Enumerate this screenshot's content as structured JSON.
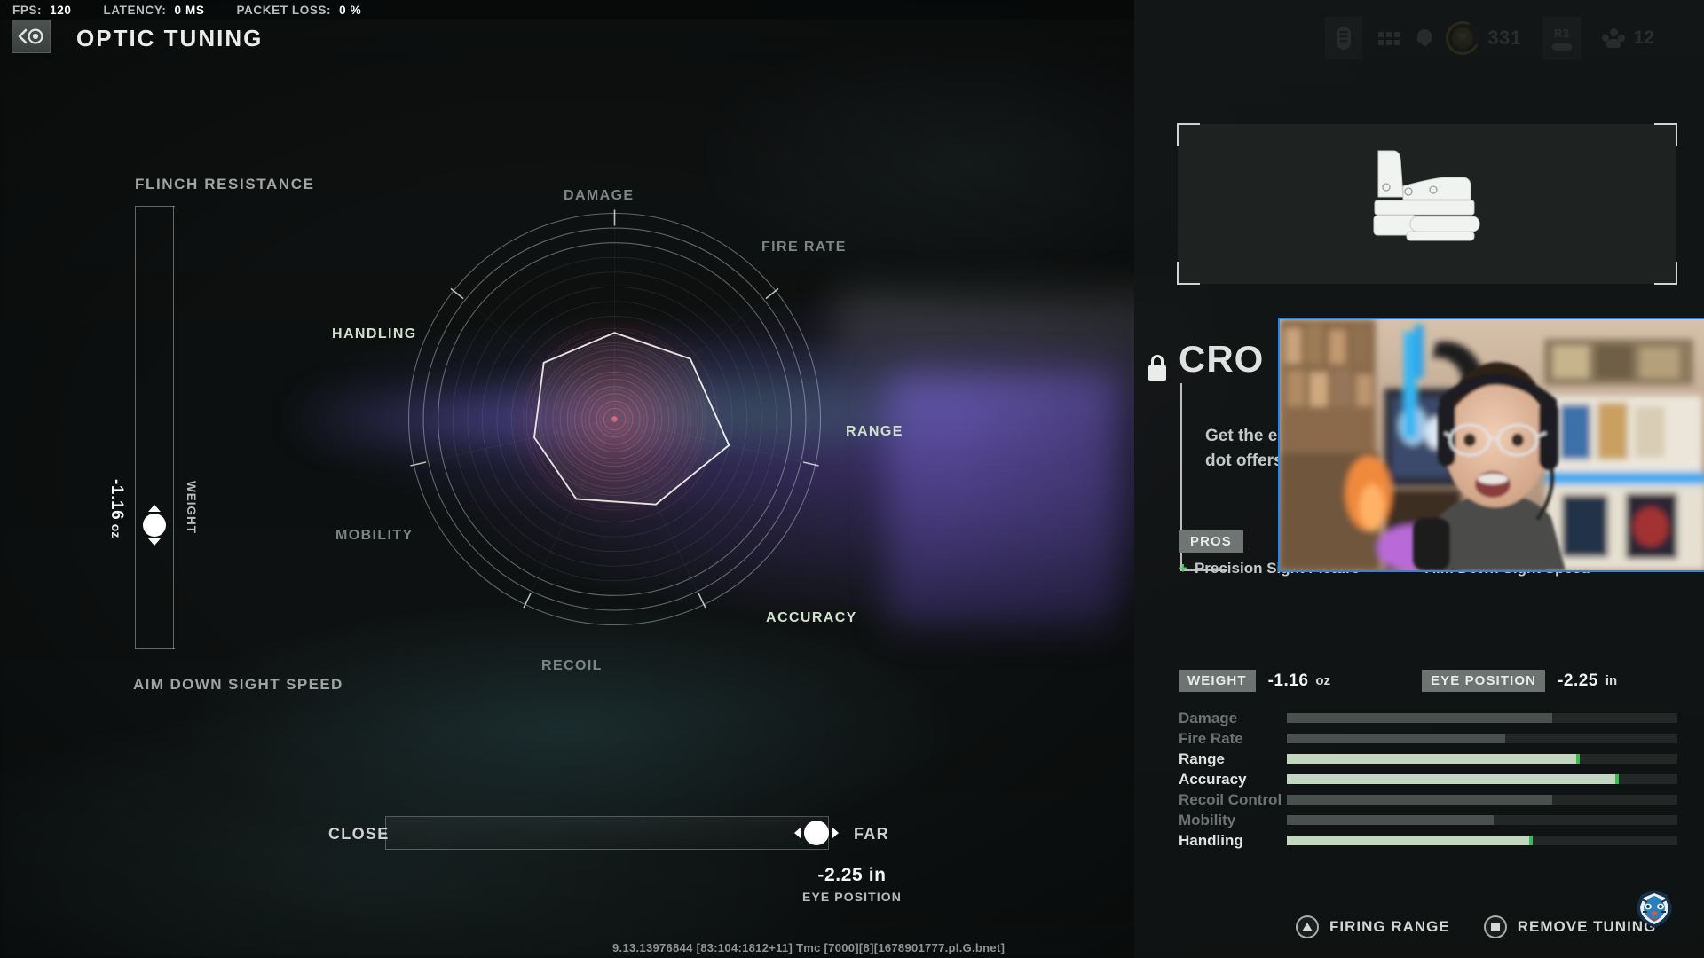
{
  "perf": {
    "items": [
      {
        "key": "FPS:",
        "value": "120"
      },
      {
        "key": "LATENCY:",
        "value": "0 MS"
      },
      {
        "key": "PACKET LOSS:",
        "value": "0 %"
      }
    ]
  },
  "header": {
    "title": "OPTIC TUNING",
    "back_icon": "back-chevron-reticle-icon"
  },
  "hud": {
    "battery_icon": "battery-icon",
    "grid_icon": "grid-menu-icon",
    "bell_icon": "notification-bell-icon",
    "rank_icon": "rank-crest-icon",
    "rank_value": "331",
    "r3_label": "R3",
    "r3_icon": "stick-click-icon",
    "squad_icon": "squad-members-icon",
    "squad_value": "12"
  },
  "vertical_slider": {
    "top_label": "FLINCH RESISTANCE",
    "bottom_label": "AIM DOWN SIGHT SPEED",
    "value": "-1.16",
    "unit": "oz",
    "caption": "WEIGHT",
    "knob_pct": 67
  },
  "horizontal_slider": {
    "left_label": "CLOSE",
    "right_label": "FAR",
    "value": "-2.25 in",
    "caption": "EYE POSITION",
    "knob_pct": 91
  },
  "chart_data": {
    "type": "radar",
    "title": "",
    "axes": [
      "DAMAGE",
      "FIRE RATE",
      "RANGE",
      "ACCURACY",
      "RECOIL",
      "MOBILITY",
      "HANDLING"
    ],
    "highlighted": [
      "RANGE",
      "ACCURACY",
      "HANDLING"
    ],
    "values": [
      0.42,
      0.47,
      0.57,
      0.46,
      0.43,
      0.4,
      0.44
    ],
    "range": [
      0,
      1
    ],
    "rings": 14,
    "legend": "none"
  },
  "attachment": {
    "lock_icon": "lock-icon",
    "name": "CRO",
    "description": "Get the edge\ndot offers a r",
    "image_icon": "red-dot-sight-icon",
    "pros_tag": "PROS",
    "pro": "Precision Sight Picture",
    "pro_sign": "+",
    "con": "Aim Down Sight Speed",
    "con_sign": "-"
  },
  "tuning": {
    "weight_tag": "WEIGHT",
    "weight_value": "-1.16",
    "weight_unit": "oz",
    "eye_tag": "EYE POSITION",
    "eye_value": "-2.25",
    "eye_unit": "in"
  },
  "stats": {
    "rows": [
      {
        "name": "Damage",
        "fill": 68,
        "lit": false
      },
      {
        "name": "Fire Rate",
        "fill": 56,
        "lit": false
      },
      {
        "name": "Range",
        "fill": 75,
        "lit": true
      },
      {
        "name": "Accuracy",
        "fill": 85,
        "lit": true
      },
      {
        "name": "Recoil Control",
        "fill": 68,
        "lit": false
      },
      {
        "name": "Mobility",
        "fill": 53,
        "lit": false
      },
      {
        "name": "Handling",
        "fill": 63,
        "lit": true
      }
    ]
  },
  "footer": {
    "firing_range_label": "FIRING RANGE",
    "firing_range_icon": "triangle-button-icon",
    "remove_tuning_label": "REMOVE TUNING",
    "remove_tuning_icon": "square-button-icon",
    "clan_icon": "tiger-emblem-icon",
    "version": "9.13.13976844 [83:104:1812+11] Tmc [7000][8][1678901777.pl.G.bnet]"
  },
  "colors": {
    "accent_green": "#3fba55",
    "bar_lit": "#c3d6c0",
    "rank_yellow": "#f0dc34",
    "webcam_border": "#2f84e0"
  }
}
